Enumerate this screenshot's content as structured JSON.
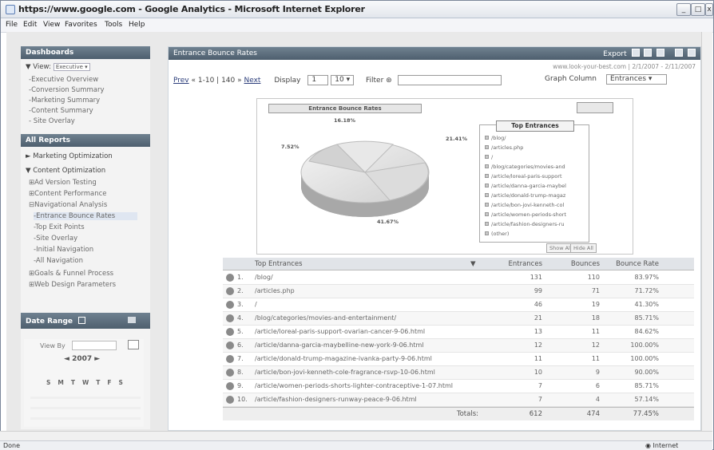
{
  "window": {
    "title": "https://www.google.com - Google Analytics - Microsoft Internet Explorer"
  },
  "menu": [
    "File",
    "Edit",
    "View",
    "Favorites",
    "Tools",
    "Help"
  ],
  "statusbar": {
    "left": "Done",
    "zone": "Internet"
  },
  "sidebar": {
    "dashboards_head": "Dashboards",
    "view_label": "View:",
    "view_value": "Executive",
    "dash_items": [
      "-Executive Overview",
      "-Conversion Summary",
      "-Marketing Summary",
      "-Content Summary",
      "- Site Overlay"
    ],
    "all_reports_head": "All Reports",
    "marketing": "Marketing Optimization",
    "content": "Content Optimization",
    "content_items": [
      "Ad Version Testing",
      "Content Performance",
      "Navigational Analysis"
    ],
    "nav_items": [
      "-Entrance Bounce Rates",
      "-Top Exit Points",
      "-Site Overlay",
      "-Initial Navigation",
      "-All Navigation"
    ],
    "more_items": [
      "Goals & Funnel Process",
      "Web Design Parameters"
    ],
    "date_head": "Date Range",
    "view_by": "View By",
    "year": "2007",
    "days": [
      "S",
      "M",
      "T",
      "W",
      "T",
      "F",
      "S"
    ]
  },
  "main": {
    "head": "Entrance Bounce Rates",
    "export_label": "Export",
    "site_date": "www.look-your-best.com | 2/1/2007 - 2/11/2007",
    "prev": "Prev",
    "range": "« 1-10 | 140 »",
    "next": "Next",
    "display_label": "Display",
    "display_from": "1",
    "display_count": "10",
    "filter_label": "Filter",
    "graph_column_label": "Graph Column",
    "graph_column_value": "Entrances"
  },
  "chart_data": {
    "type": "pie",
    "title": "Entrance Bounce Rates",
    "legend_title": "Top Entrances",
    "slice_labels": [
      "16.18%",
      "21.41%",
      "41.67%",
      "7.52%"
    ],
    "categories": [
      "/blog/",
      "/articles.php",
      "/",
      "/blog/categories/movies-and",
      "/article/loreal-paris-support",
      "/article/danna-garcia-maybel",
      "/article/donald-trump-magaz",
      "/article/bon-jovi-kenneth-col",
      "/article/women-periods-short",
      "/article/fashion-designers-ru",
      "(other)"
    ],
    "show_all": "Show All",
    "hide_all": "Hide All"
  },
  "table": {
    "headers": [
      "Top Entrances",
      "Entrances",
      "Bounces",
      "Bounce Rate"
    ],
    "rows": [
      {
        "n": "1.",
        "page": "/blog/",
        "entrances": "131",
        "bounces": "110",
        "rate": "83.97%"
      },
      {
        "n": "2.",
        "page": "/articles.php",
        "entrances": "99",
        "bounces": "71",
        "rate": "71.72%"
      },
      {
        "n": "3.",
        "page": "/",
        "entrances": "46",
        "bounces": "19",
        "rate": "41.30%"
      },
      {
        "n": "4.",
        "page": "/blog/categories/movies-and-entertainment/",
        "entrances": "21",
        "bounces": "18",
        "rate": "85.71%"
      },
      {
        "n": "5.",
        "page": "/article/loreal-paris-support-ovarian-cancer-9-06.html",
        "entrances": "13",
        "bounces": "11",
        "rate": "84.62%"
      },
      {
        "n": "6.",
        "page": "/article/danna-garcia-maybelline-new-york-9-06.html",
        "entrances": "12",
        "bounces": "12",
        "rate": "100.00%"
      },
      {
        "n": "7.",
        "page": "/article/donald-trump-magazine-ivanka-party-9-06.html",
        "entrances": "11",
        "bounces": "11",
        "rate": "100.00%"
      },
      {
        "n": "8.",
        "page": "/article/bon-jovi-kenneth-cole-fragrance-rsvp-10-06.html",
        "entrances": "10",
        "bounces": "9",
        "rate": "90.00%"
      },
      {
        "n": "9.",
        "page": "/article/women-periods-shorts-lighter-contraceptive-1-07.html",
        "entrances": "7",
        "bounces": "6",
        "rate": "85.71%"
      },
      {
        "n": "10.",
        "page": "/article/fashion-designers-runway-peace-9-06.html",
        "entrances": "7",
        "bounces": "4",
        "rate": "57.14%"
      }
    ],
    "totals_label": "Totals:",
    "totals": {
      "entrances": "612",
      "bounces": "474",
      "rate": "77.45%"
    }
  }
}
